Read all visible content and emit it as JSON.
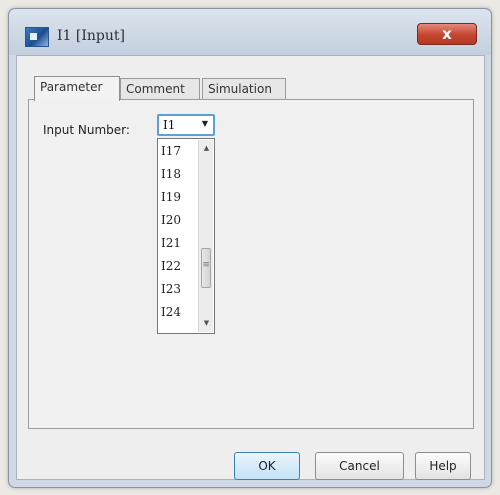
{
  "window": {
    "title": "I1 [Input]",
    "close_label": "x",
    "app_icon": "app-window-icon"
  },
  "tabs": [
    {
      "label": "Parameter",
      "active": true
    },
    {
      "label": "Comment",
      "active": false
    },
    {
      "label": "Simulation",
      "active": false
    }
  ],
  "form": {
    "input_number_label": "Input Number:",
    "selected_value": "I1",
    "options_visible": [
      "I17",
      "I18",
      "I19",
      "I20",
      "I21",
      "I22",
      "I23",
      "I24"
    ]
  },
  "buttons": {
    "ok": "OK",
    "cancel": "Cancel",
    "help": "Help"
  },
  "colors": {
    "focus_border": "#5d9fd8",
    "close_button": "#c5452f",
    "window_frame": "#cfd9e6"
  }
}
